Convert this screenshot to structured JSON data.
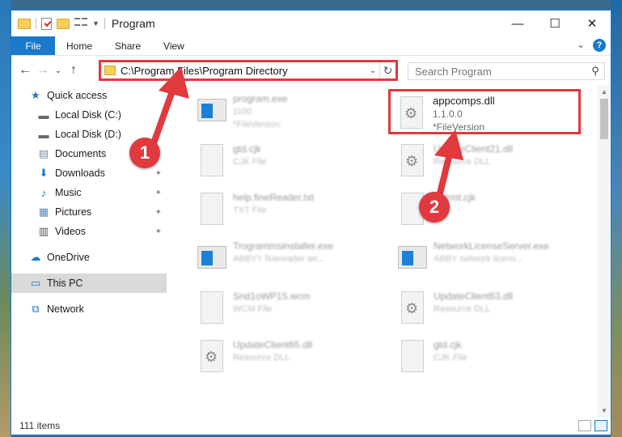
{
  "window": {
    "title": "Program",
    "controls": {
      "minimize": "—",
      "maximize": "☐",
      "close": "✕"
    }
  },
  "ribbon": {
    "file": "File",
    "tabs": [
      "Home",
      "Share",
      "View"
    ],
    "expand": "⌄",
    "help": "?"
  },
  "nav": {
    "back": "←",
    "forward": "→",
    "recent": "⌄",
    "up": "↑",
    "address": "C:\\Program Files\\Program Directory",
    "address_chevron": "⌄",
    "refresh": "↻",
    "search_placeholder": "Search Program",
    "search_icon": "⚲"
  },
  "sidebar": {
    "items": [
      {
        "label": "Quick access",
        "icon": "star-icon",
        "glyph": "★",
        "color": "#1979ca"
      },
      {
        "label": "Local Disk (C:)",
        "icon": "drive-icon",
        "glyph": "▬",
        "pin": ""
      },
      {
        "label": "Local Disk (D:)",
        "icon": "drive-icon",
        "glyph": "▬",
        "pin": ""
      },
      {
        "label": "Documents",
        "icon": "documents-icon",
        "glyph": "▤",
        "pin": ""
      },
      {
        "label": "Downloads",
        "icon": "downloads-icon",
        "glyph": "⬇",
        "pin": "📌"
      },
      {
        "label": "Music",
        "icon": "music-icon",
        "glyph": "♪",
        "pin": "📌"
      },
      {
        "label": "Pictures",
        "icon": "pictures-icon",
        "glyph": "▦",
        "pin": "📌"
      },
      {
        "label": "Videos",
        "icon": "videos-icon",
        "glyph": "▥",
        "pin": "📌"
      },
      {
        "label": "OneDrive",
        "icon": "cloud-icon",
        "glyph": "☁"
      },
      {
        "label": "This PC",
        "icon": "computer-icon",
        "glyph": "▭"
      },
      {
        "label": "Network",
        "icon": "network-icon",
        "glyph": "⧉"
      }
    ]
  },
  "files": {
    "items": [
      {
        "name": "program.exe",
        "sub": "1100",
        "sub2": "*FileVersion",
        "kind": "exe"
      },
      {
        "name": "appcomps.dll",
        "sub": "1.1.0.0",
        "sub2": "*FileVersion",
        "kind": "dll"
      },
      {
        "name": "gtd.cjk",
        "sub": "CJK File",
        "kind": "doc"
      },
      {
        "name": "UpdateClient21.dll",
        "sub": "Resource DLL",
        "kind": "dll"
      },
      {
        "name": "help.fineReader.txt",
        "sub": "TXT File",
        "kind": "doc"
      },
      {
        "name": "gtdrmt.cjk",
        "sub": "File",
        "kind": "doc"
      },
      {
        "name": "Trogrammsinstaller.exe",
        "sub": "ABBYY finereader ter...",
        "kind": "exe"
      },
      {
        "name": "NetworkLicenseServer.exe",
        "sub": "ABBY network licens...",
        "kind": "exe"
      },
      {
        "name": "Snd1oWP15.wcm",
        "sub": "WCM File",
        "kind": "doc"
      },
      {
        "name": "UpdateClient63.dll",
        "sub": "Resource DLL",
        "kind": "dll"
      },
      {
        "name": "UpdateClient65.dll",
        "sub": "Resource DLL",
        "kind": "dll"
      },
      {
        "name": "gtd.cjk",
        "sub": "CJK File",
        "kind": "doc"
      }
    ]
  },
  "status": {
    "count": "111 items"
  },
  "annotations": {
    "step1": "1",
    "step2": "2",
    "color": "#e0393e"
  },
  "scroll": {
    "up": "▲",
    "down": "▼"
  }
}
